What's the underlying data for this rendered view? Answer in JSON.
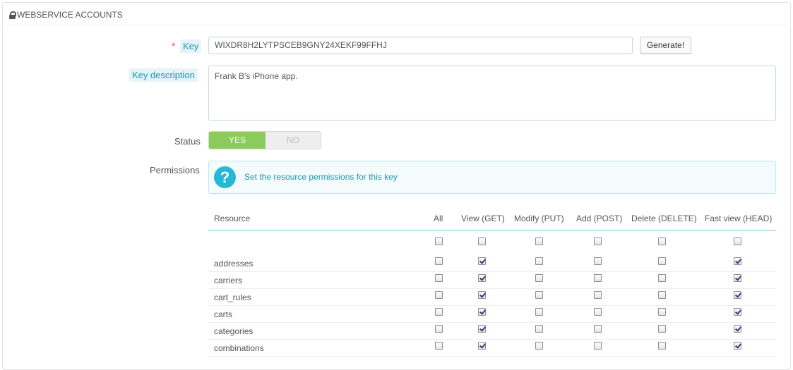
{
  "panel": {
    "title": "WEBSERVICE ACCOUNTS",
    "title_icon": "lock-icon"
  },
  "form": {
    "key_required_mark": "*",
    "key_label": "Key",
    "key_value": "WIXDR8H2LYTPSCEB9GNY24XEKF99FFHJ",
    "generate_label": "Generate!",
    "desc_label": "Key description",
    "desc_value": "Frank B's iPhone app.",
    "status_label": "Status",
    "status_yes": "YES",
    "status_no": "NO",
    "status_selected": "YES",
    "permissions_label": "Permissions",
    "permissions_hint": "Set the resource permissions for this key",
    "hint_icon": "question-icon"
  },
  "colors": {
    "switch_on": "#8bcb5b",
    "accent": "#25b9d7",
    "hint_text": "#1e94ab",
    "required": "#e0533c"
  },
  "table": {
    "headers": [
      "Resource",
      "All",
      "View (GET)",
      "Modify (PUT)",
      "Add (POST)",
      "Delete (DELETE)",
      "Fast view (HEAD)"
    ],
    "select_all": [
      false,
      false,
      false,
      false,
      false,
      false
    ],
    "rows": [
      {
        "name": "addresses",
        "checks": [
          false,
          true,
          false,
          false,
          false,
          true
        ]
      },
      {
        "name": "carriers",
        "checks": [
          false,
          true,
          false,
          false,
          false,
          true
        ]
      },
      {
        "name": "cart_rules",
        "checks": [
          false,
          true,
          false,
          false,
          false,
          true
        ]
      },
      {
        "name": "carts",
        "checks": [
          false,
          true,
          false,
          false,
          false,
          true
        ]
      },
      {
        "name": "categories",
        "checks": [
          false,
          true,
          false,
          false,
          false,
          true
        ]
      },
      {
        "name": "combinations",
        "checks": [
          false,
          true,
          false,
          false,
          false,
          true
        ]
      }
    ]
  }
}
